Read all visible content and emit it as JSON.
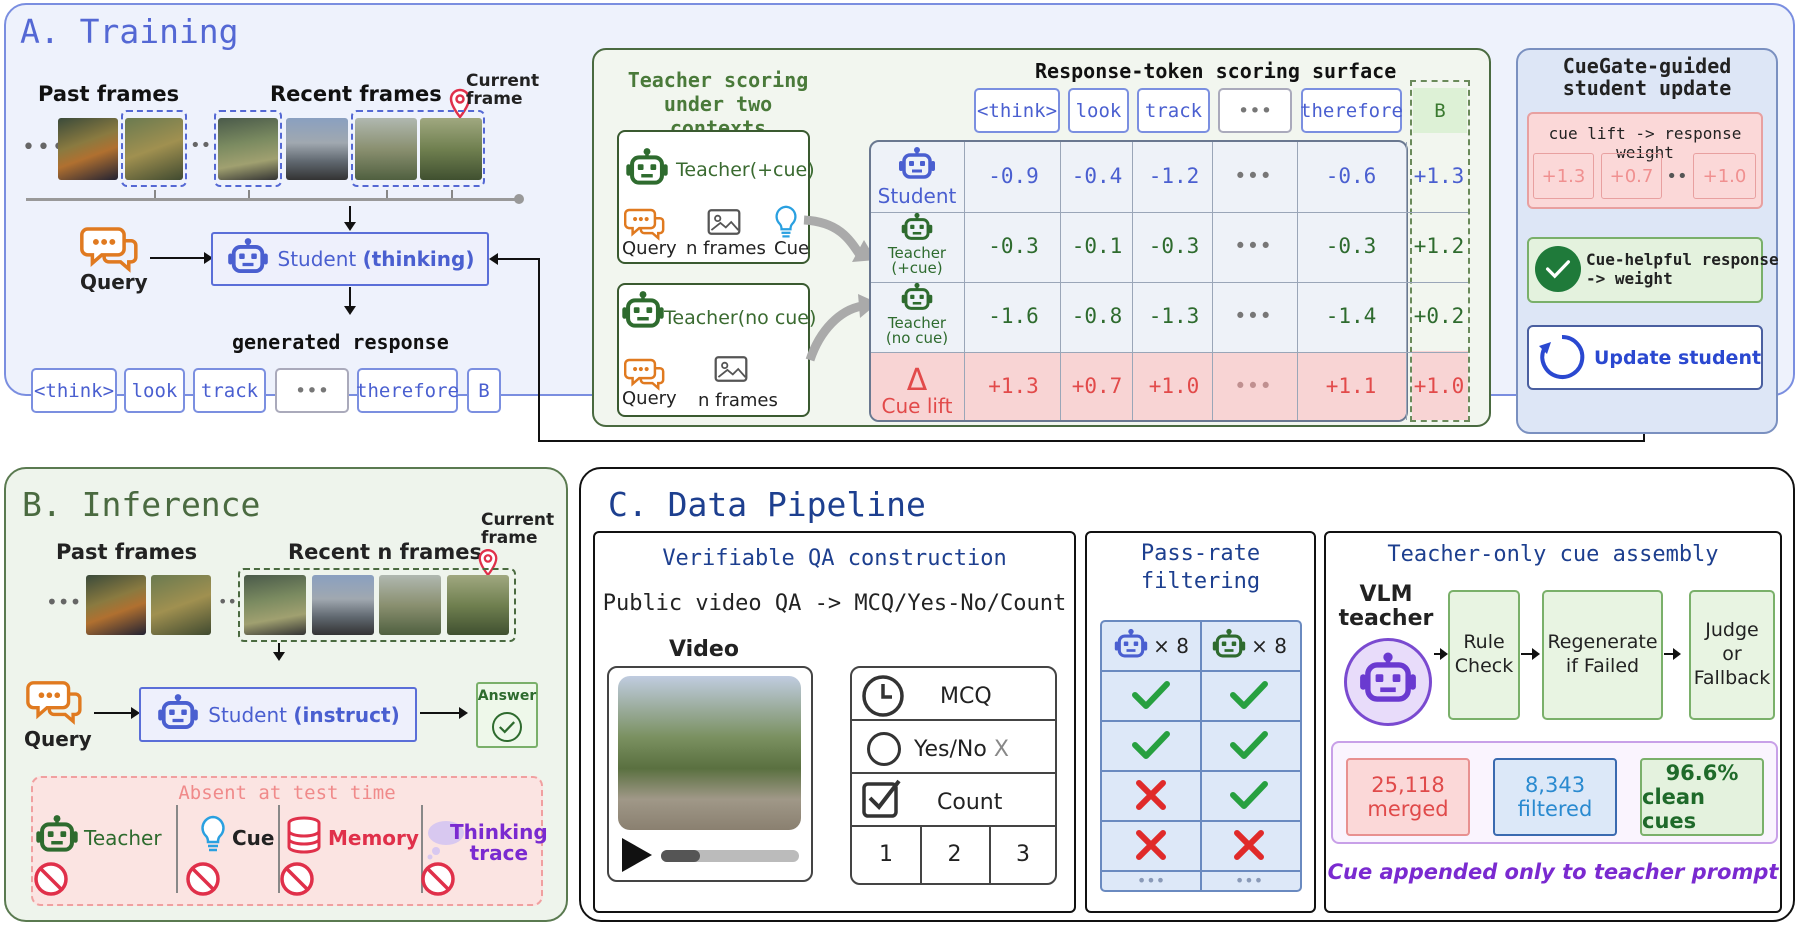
{
  "training": {
    "title": "A. Training",
    "past_frames": "Past frames",
    "recent_frames": "Recent frames",
    "current_frame": [
      "Current",
      "frame"
    ],
    "query": "Query",
    "student_prefix": "Student ",
    "student_mode": "(thinking)",
    "generated_response": "generated response",
    "tokens": [
      "<think>",
      "look",
      "track",
      "•••",
      "therefore",
      "B"
    ]
  },
  "teacher_scoring": {
    "title": [
      "Teacher scoring",
      "under two contexts"
    ],
    "teacher_cue": "Teacher(+cue)",
    "teacher_nocue": "Teacher(no cue)",
    "query": "Query",
    "n_frames": "n frames",
    "cue": "Cue"
  },
  "surface": {
    "title": "Response-token scoring surface",
    "tokens": [
      "<think>",
      "look",
      "track",
      "•••",
      "therefore",
      "B"
    ],
    "rows": [
      {
        "label": [
          "Student"
        ],
        "values": [
          "-0.9",
          "-0.4",
          "-1.2",
          "•••",
          "-0.6"
        ],
        "b": "+1.3"
      },
      {
        "label": [
          "Teacher",
          "(+cue)"
        ],
        "values": [
          "-0.3",
          "-0.1",
          "-0.3",
          "•••",
          "-0.3"
        ],
        "b": "+1.2"
      },
      {
        "label": [
          "Teacher",
          "(no cue)"
        ],
        "values": [
          "-1.6",
          "-0.8",
          "-1.3",
          "•••",
          "-1.4"
        ],
        "b": "+0.2"
      },
      {
        "label": [
          "Cue lift"
        ],
        "values": [
          "+1.3",
          "+0.7",
          "+1.0",
          "•••",
          "+1.1"
        ],
        "b": "+1.0"
      }
    ],
    "delta": "Δ"
  },
  "cuegate": {
    "title": [
      "CueGate-guided",
      "student update"
    ],
    "lift_label": "cue lift -> response weight",
    "lift_values": [
      "+1.3",
      "+0.7",
      "••",
      "+1.0"
    ],
    "helpful": [
      "Cue-helpful response",
      "-> weight"
    ],
    "update": "Update student"
  },
  "inference": {
    "title": "B. Inference",
    "past_frames": "Past frames",
    "recent_frames": "Recent n frames",
    "current_frame": [
      "Current",
      "frame"
    ],
    "query": "Query",
    "student_prefix": "Student ",
    "student_mode": "(instruct)",
    "answer": "Answer",
    "absent_title": "Absent at test time",
    "absent_items": [
      "Teacher",
      "Cue",
      "Memory",
      "Thinking",
      "trace"
    ]
  },
  "pipeline": {
    "title": "C. Data Pipeline",
    "qa_title": "Verifiable QA construction",
    "qa_sub": "Public video QA -> MCQ/Yes-No/Count",
    "video": "Video",
    "mcq": "MCQ",
    "yesno": "Yes/No",
    "x_mark": "X",
    "count": "Count",
    "count_nums": [
      "1",
      "2",
      "3"
    ],
    "pass_title": [
      "Pass-rate",
      "filtering"
    ],
    "pass_headers": [
      "× 8",
      "× 8"
    ],
    "pass_rows": [
      [
        "check",
        "check"
      ],
      [
        "check",
        "check"
      ],
      [
        "cross",
        "check"
      ],
      [
        "cross",
        "cross"
      ]
    ],
    "dots": "•••",
    "cue_title": "Teacher-only cue assembly",
    "vlm": [
      "VLM",
      "teacher"
    ],
    "steps": [
      [
        "Rule",
        "Check"
      ],
      [
        "Regenerate",
        "if Failed"
      ],
      [
        "Judge",
        "or",
        "Fallback"
      ]
    ],
    "stats": [
      {
        "value": "25,118",
        "label": "merged"
      },
      {
        "value": "8,343",
        "label": "filtered"
      },
      {
        "value": "96.6%",
        "label": "clean cues"
      }
    ],
    "footnote": "Cue appended only to teacher prompt"
  },
  "colors": {
    "training_bg": "#eef2fc",
    "training_border": "#7a8ee0",
    "inference_bg": "#eef4ec",
    "inference_border": "#5a7a50",
    "student_blue": "#4a5fd0",
    "teacher_green": "#2e6b2e",
    "lift_red": "#e24a4a",
    "pipeline_navy": "#1d3f8f"
  }
}
